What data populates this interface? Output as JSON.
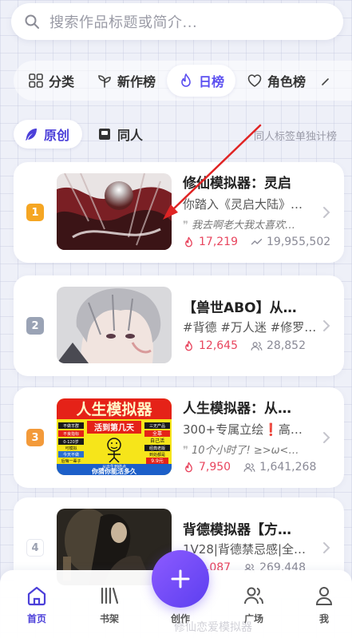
{
  "search": {
    "placeholder": "搜索作品标题或简介..."
  },
  "categories": [
    {
      "label": "分类",
      "icon": "grid-icon",
      "active": false
    },
    {
      "label": "新作榜",
      "icon": "sprout-icon",
      "active": false
    },
    {
      "label": "日榜",
      "icon": "flame-icon",
      "active": true
    },
    {
      "label": "角色榜",
      "icon": "heart-icon",
      "active": false
    }
  ],
  "subtabs": [
    {
      "label": "原创",
      "icon": "feather-icon",
      "active": true
    },
    {
      "label": "同人",
      "icon": "book-icon",
      "active": false
    }
  ],
  "subtab_hint": "同人标签单独计榜",
  "colors": {
    "accent": "#4b3fd9",
    "heat": "#e8455e",
    "rank_gold": "#f5a623",
    "rank_silver": "#9aa3b5",
    "rank_bronze": "#f39a3a"
  },
  "works": [
    {
      "rank": "1",
      "title": "修仙模拟器：灵启",
      "desc": "你踏入《灵启大陆》…",
      "quote": "我去啊老大我太喜欢…",
      "heat": "17,219",
      "reads": "19,955,502"
    },
    {
      "rank": "2",
      "title": "【兽世ABO】从…",
      "desc": "#背德 #万人迷 #修罗…",
      "quote": "",
      "heat": "12,645",
      "reads": "28,852"
    },
    {
      "rank": "3",
      "title": "人生模拟器：从…",
      "desc": "300+专属立绘❗高…",
      "quote": "10个小时了! ≥>ω<…",
      "heat": "7,950",
      "reads": "1,641,268"
    },
    {
      "rank": "4",
      "title": "背德模拟器【方…",
      "desc": "1V28|背德禁忌感|全…",
      "quote": "",
      "heat": "4,087",
      "reads": "269,448"
    }
  ],
  "poster3": {
    "headline": "人生模拟器",
    "banner": "活到第几天",
    "tags": [
      "不做羊群",
      "不良指标",
      "0-120岁",
      "可模拟",
      "今天不做",
      "后悔一辈子",
      "三无产品",
      "全靠",
      "自己活",
      "经典老版",
      "到处都是",
      "9.9元"
    ],
    "bottom_small": "从出生到终点",
    "bottom_big": "你猜你能活多久"
  },
  "nav": {
    "home": "首页",
    "shelf": "书架",
    "create": "创作",
    "plaza": "广场",
    "me": "我"
  },
  "peek_text": "修仙恋爱模拟器"
}
